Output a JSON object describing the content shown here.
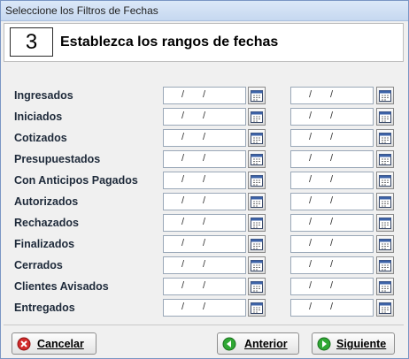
{
  "window": {
    "title": "Seleccione los Filtros de Fechas"
  },
  "step": {
    "number": "3",
    "heading": "Establezca los rangos de fechas"
  },
  "date_placeholder_sep": "/",
  "rows": [
    {
      "label": "Ingresados"
    },
    {
      "label": "Iniciados"
    },
    {
      "label": "Cotizados"
    },
    {
      "label": "Presupuestados"
    },
    {
      "label": "Con Anticipos Pagados"
    },
    {
      "label": "Autorizados"
    },
    {
      "label": "Rechazados"
    },
    {
      "label": "Finalizados"
    },
    {
      "label": "Cerrados"
    },
    {
      "label": "Clientes Avisados"
    },
    {
      "label": "Entregados"
    }
  ],
  "buttons": {
    "cancel": "Cancelar",
    "previous": "Anterior",
    "next": "Siguiente"
  },
  "colors": {
    "cancel_icon": "#d22a2a",
    "nav_icon": "#2fa834",
    "label_text": "#1e2a3a"
  },
  "icons": {
    "calendar": "calendar-icon",
    "cancel": "cancel-icon",
    "previous": "arrow-left-icon",
    "next": "arrow-right-icon"
  }
}
